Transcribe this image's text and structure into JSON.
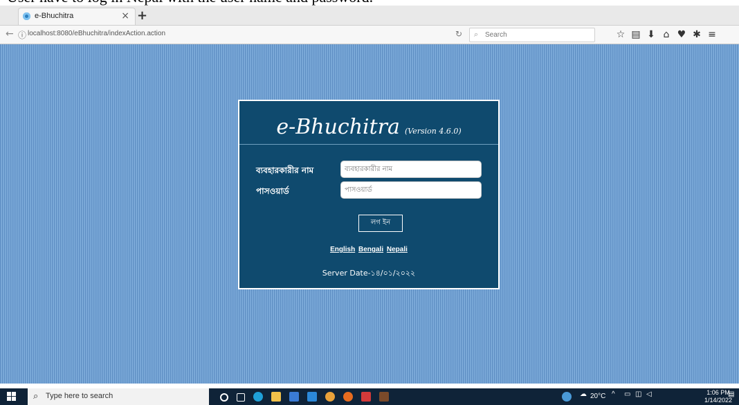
{
  "caption": "User have to log in Nepal with the user name and password.",
  "browser": {
    "tab_title": "e-Bhuchitra",
    "tab_close": "×",
    "new_tab": "+",
    "url": "localhost:8080/eBhuchitra/indexAction.action",
    "search_placeholder": "Search"
  },
  "login": {
    "app_name": "e-Bhuchitra",
    "version": "(Version 4.6.0)",
    "username_label": "ব্যবহারকারীর নাম",
    "username_placeholder": "ব্যবহারকারীর নাম",
    "password_label": "পাসওয়ার্ড",
    "password_placeholder": "পাসওয়ার্ড",
    "login_button": "লগ ইন",
    "languages": [
      "English",
      "Bengali",
      "Nepali"
    ],
    "server_date": "Server Date-১৪/০১/২০২২"
  },
  "colors": {
    "panel_bg": "#0f4a6e",
    "page_bg": "#6f9fd0",
    "taskbar_bg": "#0f2338"
  },
  "taskbar": {
    "search_text": "Type here to search",
    "weather": "20°C",
    "time": "1:06 PM",
    "date": "1/14/2022"
  }
}
